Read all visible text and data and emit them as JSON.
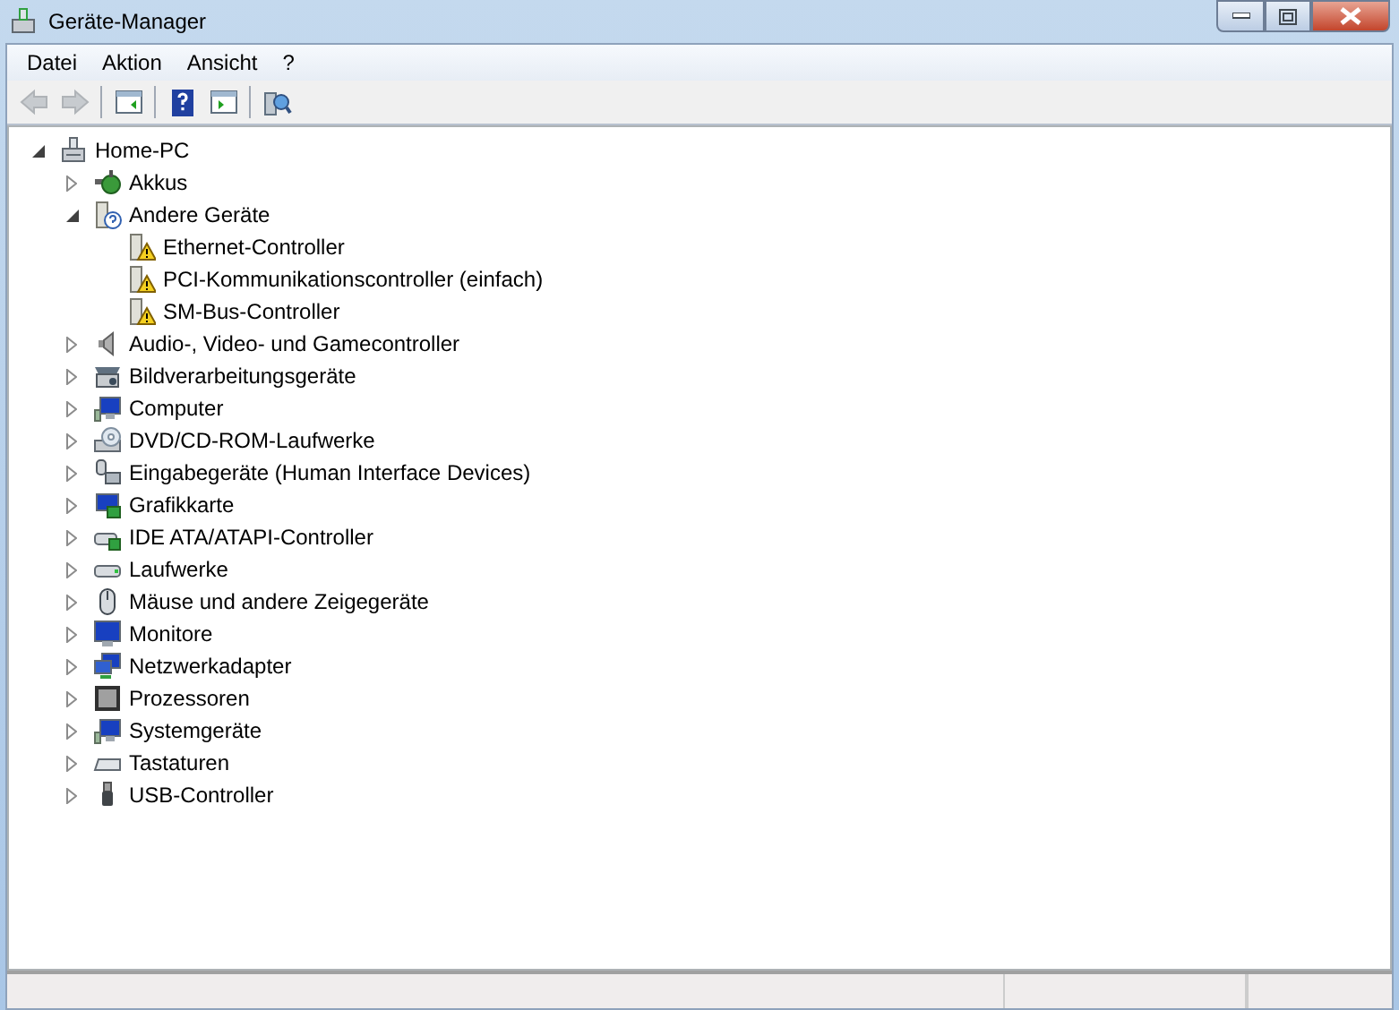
{
  "window": {
    "title": "Geräte-Manager"
  },
  "menu": [
    "Datei",
    "Aktion",
    "Ansicht",
    "?"
  ],
  "toolbar": [
    {
      "kind": "back",
      "disabled": true
    },
    {
      "kind": "forward",
      "disabled": true
    },
    {
      "kind": "sep"
    },
    {
      "kind": "properties",
      "disabled": false
    },
    {
      "kind": "sep"
    },
    {
      "kind": "help",
      "disabled": false
    },
    {
      "kind": "view",
      "disabled": false
    },
    {
      "kind": "sep"
    },
    {
      "kind": "scan",
      "disabled": false
    }
  ],
  "tree": [
    {
      "label": "Home-PC",
      "kind": "pc",
      "expanded": true,
      "children": [
        {
          "label": "Akkus",
          "kind": "battery",
          "expanded": false
        },
        {
          "label": "Andere Geräte",
          "kind": "unknown",
          "expanded": true,
          "children": [
            {
              "label": "Ethernet-Controller",
              "kind": "warning"
            },
            {
              "label": "PCI-Kommunikationscontroller (einfach)",
              "kind": "warning"
            },
            {
              "label": "SM-Bus-Controller",
              "kind": "warning"
            }
          ]
        },
        {
          "label": "Audio-, Video- und Gamecontroller",
          "kind": "speaker",
          "expanded": false
        },
        {
          "label": "Bildverarbeitungsgeräte",
          "kind": "scanner",
          "expanded": false
        },
        {
          "label": "Computer",
          "kind": "computer",
          "expanded": false
        },
        {
          "label": "DVD/CD-ROM-Laufwerke",
          "kind": "disc",
          "expanded": false
        },
        {
          "label": "Eingabegeräte (Human Interface Devices)",
          "kind": "hid",
          "expanded": false
        },
        {
          "label": "Grafikkarte",
          "kind": "display",
          "expanded": false
        },
        {
          "label": "IDE ATA/ATAPI-Controller",
          "kind": "ide",
          "expanded": false
        },
        {
          "label": "Laufwerke",
          "kind": "drive",
          "expanded": false
        },
        {
          "label": "Mäuse und andere Zeigegeräte",
          "kind": "mouse",
          "expanded": false
        },
        {
          "label": "Monitore",
          "kind": "monitor",
          "expanded": false
        },
        {
          "label": "Netzwerkadapter",
          "kind": "network",
          "expanded": false
        },
        {
          "label": "Prozessoren",
          "kind": "cpu",
          "expanded": false
        },
        {
          "label": "Systemgeräte",
          "kind": "computer",
          "expanded": false
        },
        {
          "label": "Tastaturen",
          "kind": "keyboard",
          "expanded": false
        },
        {
          "label": "USB-Controller",
          "kind": "usb",
          "expanded": false
        }
      ]
    }
  ]
}
